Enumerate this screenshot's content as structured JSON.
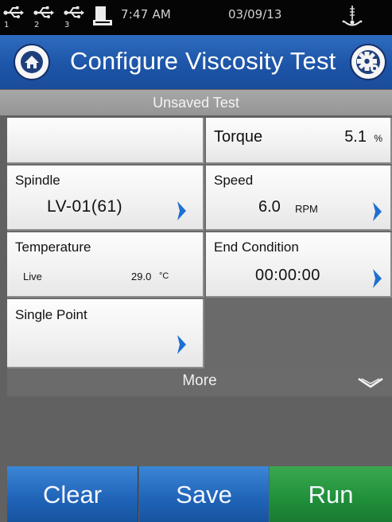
{
  "status_bar": {
    "usb_ports": [
      "1",
      "2",
      "3"
    ],
    "time": "7:47 AM",
    "date": "03/09/13",
    "icons": [
      "usb-icon",
      "printer-icon",
      "level-icon"
    ]
  },
  "header": {
    "title": "Configure Viscosity Test",
    "home_icon": "home-icon",
    "settings_icon": "gear-icon"
  },
  "test_status": "Unsaved Test",
  "parameters": {
    "torque": {
      "label": "Torque",
      "value": "5.1",
      "unit": "%"
    },
    "spindle": {
      "label": "Spindle",
      "value": "LV-01(61)"
    },
    "speed": {
      "label": "Speed",
      "value": "6.0",
      "unit": "RPM"
    },
    "temperature": {
      "label": "Temperature",
      "mode": "Live",
      "value": "29.0",
      "unit": "°C"
    },
    "end_condition": {
      "label": "End Condition",
      "value": "00:00:00"
    },
    "method": {
      "label": "Single Point"
    }
  },
  "more": {
    "label": "More"
  },
  "actions": {
    "clear": "Clear",
    "save": "Save",
    "run": "Run"
  },
  "colors": {
    "title_bar": "#1d55a8",
    "action_blue": "#1f63b7",
    "action_green": "#1f8f3a",
    "chevron": "#1e6fd0"
  }
}
